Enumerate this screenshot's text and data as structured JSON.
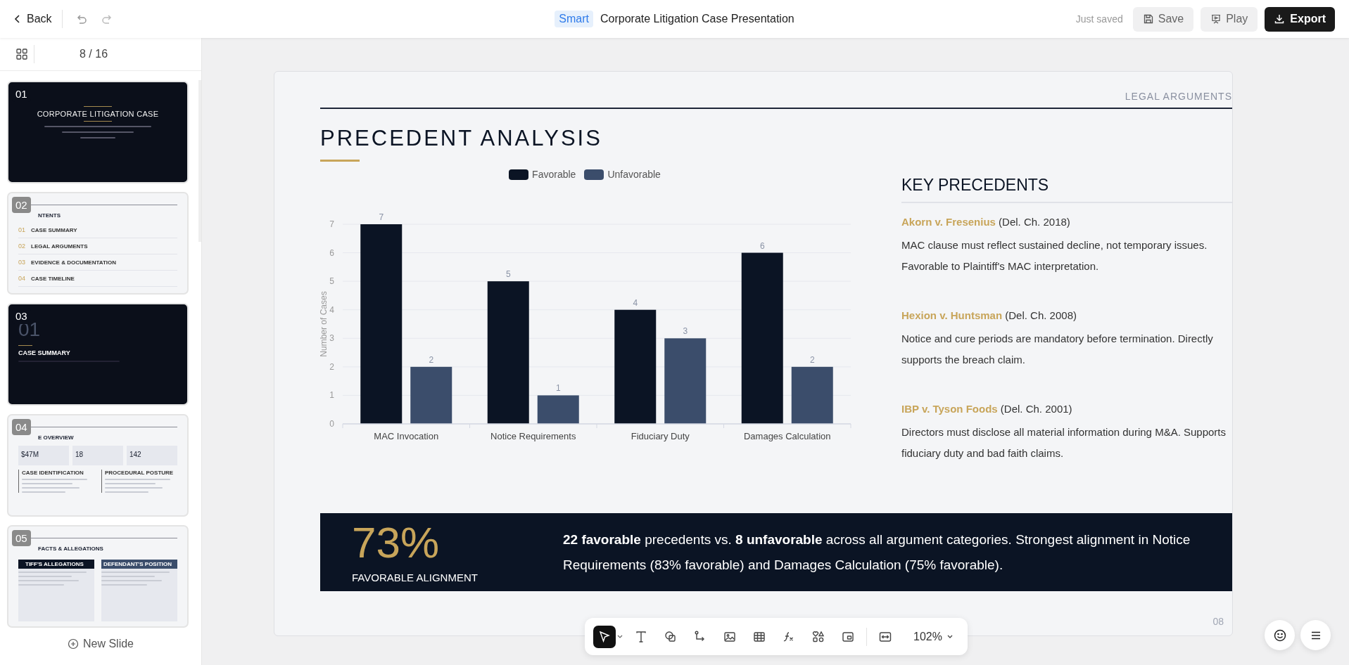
{
  "topbar": {
    "back": "Back",
    "badge": "Smart",
    "title": "Corporate Litigation Case Presentation",
    "status": "Just saved",
    "buttons": [
      {
        "kind": "save",
        "label": "Save"
      },
      {
        "kind": "play",
        "label": "Play"
      },
      {
        "kind": "export",
        "label": "Export"
      }
    ]
  },
  "sidebar": {
    "counter": "8 / 16",
    "new_slide": "New Slide",
    "thumbnails": [
      {
        "number": "01",
        "kind": "cover",
        "title": "CORPORATE LITIGATION CASE"
      },
      {
        "number": "02",
        "kind": "contents",
        "title": "NTENTS",
        "items": [
          {
            "number": "01",
            "label": "CASE SUMMARY"
          },
          {
            "number": "02",
            "label": "LEGAL ARGUMENTS"
          },
          {
            "number": "03",
            "label": "EVIDENCE & DOCUMENTATION"
          },
          {
            "number": "04",
            "label": "CASE TIMELINE"
          }
        ]
      },
      {
        "number": "03",
        "kind": "section",
        "big_number": "01",
        "title": "CASE SUMMARY"
      },
      {
        "number": "04",
        "kind": "overview",
        "title": "E OVERVIEW",
        "stats": [
          "$47M",
          "18",
          "142"
        ],
        "columns": [
          "CASE IDENTIFICATION",
          "PROCEDURAL POSTURE"
        ]
      },
      {
        "number": "05",
        "kind": "panels",
        "title": "FACTS & ALLEGATIONS",
        "columns": [
          "TIFF'S ALLEGATIONS",
          "DEFENDANT'S POSITION"
        ]
      }
    ]
  },
  "slide": {
    "section": "LEGAL ARGUMENTS",
    "title": "PRECEDENT ANALYSIS",
    "page": "08",
    "chart_data": {
      "type": "bar",
      "ylabel": "Number of Cases",
      "categories": [
        "MAC Invocation",
        "Notice Requirements",
        "Fiduciary Duty",
        "Damages Calculation"
      ],
      "series": [
        {
          "name": "Favorable",
          "color": "#0b1424",
          "values": [
            7,
            5,
            4,
            6
          ]
        },
        {
          "name": "Unfavorable",
          "color": "#3b4d6b",
          "values": [
            2,
            1,
            3,
            2
          ]
        }
      ],
      "ylim": [
        0,
        7
      ],
      "yticks": [
        0,
        1,
        2,
        3,
        4,
        5,
        6,
        7
      ],
      "data_labels": true,
      "grid": true,
      "legend": true
    },
    "precedents_title": "KEY PRECEDENTS",
    "precedents": [
      {
        "citation": "**Akorn v. Fresenius** (Del. Ch. 2018)",
        "text": "MAC clause must reflect sustained decline, not temporary issues. Favorable to Plaintiff's MAC interpretation."
      },
      {
        "citation": "**Hexion v. Huntsman** (Del. Ch. 2008)",
        "text": "Notice and cure periods are mandatory before termination. Directly supports the breach claim."
      },
      {
        "citation": "**IBP v. Tyson Foods** (Del. Ch. 2001)",
        "text": "Directors must disclose all material information during M&A. Supports fiduciary duty and bad faith claims."
      }
    ],
    "banner": {
      "value": "73%",
      "label": "FAVORABLE ALIGNMENT",
      "text": "**22 favorable** precedents vs. **8 unfavorable** across all argument categories. Strongest alignment in Notice Requirements (83% favorable) and Damages Calculation (75% favorable)."
    }
  },
  "toolbar": {
    "tools": [
      {
        "kind": "select",
        "selected": true
      },
      {
        "kind": "text",
        "selected": false
      },
      {
        "kind": "shape",
        "selected": false
      },
      {
        "kind": "connector",
        "selected": false
      },
      {
        "kind": "image",
        "selected": false
      },
      {
        "kind": "table",
        "selected": false
      },
      {
        "kind": "formula",
        "selected": false
      },
      {
        "kind": "elements",
        "selected": false
      },
      {
        "kind": "media",
        "selected": false
      },
      {
        "kind": "fit",
        "selected": false
      }
    ],
    "zoom": "102%"
  }
}
